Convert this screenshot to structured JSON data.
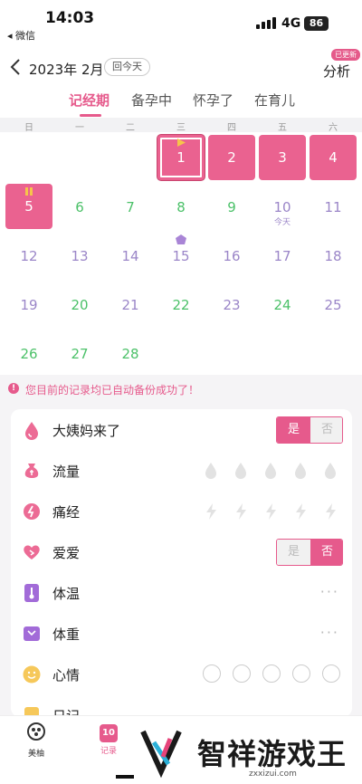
{
  "status_bar": {
    "time": "14:03",
    "back_app": "◂ 微信",
    "network": "4G",
    "battery": "86"
  },
  "header": {
    "title": "2023年 2月",
    "today_button": "回今天",
    "analysis": "分析",
    "badge": "已更新"
  },
  "tabs": [
    "记经期",
    "备孕中",
    "怀孕了",
    "在育儿"
  ],
  "weekdays": [
    "日",
    "一",
    "二",
    "三",
    "四",
    "五",
    "六"
  ],
  "calendar": {
    "period_days": [
      "1",
      "2",
      "3",
      "4",
      "5"
    ],
    "rows": [
      [
        "6",
        "7",
        "8",
        "9",
        "10",
        "11"
      ],
      [
        "12",
        "13",
        "14",
        "15",
        "16",
        "17",
        "18"
      ],
      [
        "19",
        "20",
        "21",
        "22",
        "23",
        "24",
        "25"
      ],
      [
        "26",
        "27",
        "28"
      ]
    ],
    "today_label": "今天"
  },
  "notice": "您目前的记录均已自动备份成功了！",
  "records": {
    "period": {
      "label": "大姨妈来了",
      "yes": "是",
      "no": "否"
    },
    "flow": {
      "label": "流量"
    },
    "cramps": {
      "label": "痛经"
    },
    "love": {
      "label": "爱爱",
      "yes": "是",
      "no": "否"
    },
    "temp": {
      "label": "体温",
      "more": "···"
    },
    "weight": {
      "label": "体重",
      "more": "···"
    },
    "mood": {
      "label": "心情"
    },
    "diary": {
      "label": "日记"
    }
  },
  "bottom_nav": {
    "home": "美柚",
    "record": "记录",
    "record_icon": "10"
  },
  "watermark": {
    "title": "智祥游戏王",
    "url": "zxxizui.com"
  },
  "colors": {
    "accent": "#e65a8c",
    "green": "#4cc169",
    "purple": "#9b86c8"
  }
}
